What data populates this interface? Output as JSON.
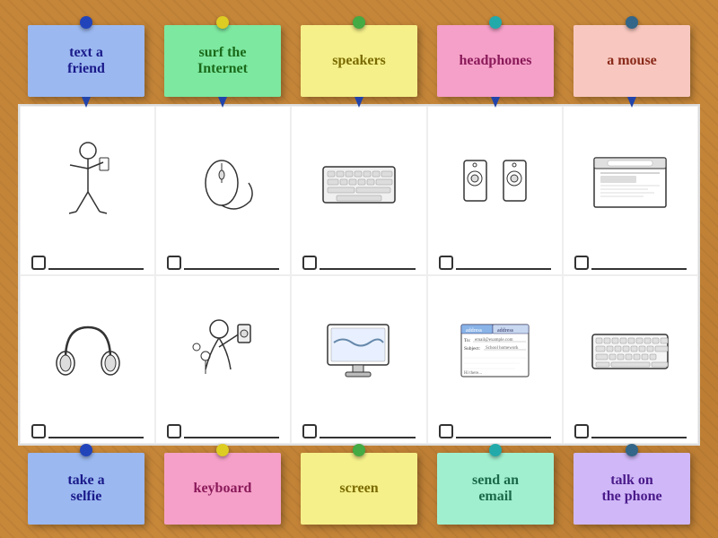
{
  "colors": {
    "cork": "#c8883a",
    "white": "#ffffff"
  },
  "top_notes": [
    {
      "id": "text-a-friend",
      "label": "text a\nfriend",
      "color": "note-blue",
      "pin": "pin-blue"
    },
    {
      "id": "surf-internet",
      "label": "surf the\nInternet",
      "color": "note-green",
      "pin": "pin-yellow"
    },
    {
      "id": "speakers",
      "label": "speakers",
      "color": "note-yellow",
      "pin": "pin-green"
    },
    {
      "id": "headphones",
      "label": "headphones",
      "color": "note-pink",
      "pin": "pin-teal"
    },
    {
      "id": "a-mouse",
      "label": "a mouse",
      "color": "note-salmon",
      "pin": "pin-dark"
    }
  ],
  "bottom_notes": [
    {
      "id": "take-selfie",
      "label": "take a\nselfie",
      "color": "note-blue",
      "pin": "pin-blue"
    },
    {
      "id": "keyboard",
      "label": "keyboard",
      "color": "note-pink",
      "pin": "pin-yellow"
    },
    {
      "id": "screen",
      "label": "screen",
      "color": "note-yellow",
      "pin": "pin-green"
    },
    {
      "id": "send-email",
      "label": "send an\nemail",
      "color": "note-mint",
      "pin": "pin-teal"
    },
    {
      "id": "talk-phone",
      "label": "talk on\nthe phone",
      "color": "note-lavender",
      "pin": "pin-dark"
    }
  ],
  "grid_cells": [
    {
      "id": "cell-person",
      "row": 1,
      "col": 1
    },
    {
      "id": "cell-mouse",
      "row": 1,
      "col": 2
    },
    {
      "id": "cell-keyboard-top",
      "row": 1,
      "col": 3
    },
    {
      "id": "cell-speakers",
      "row": 1,
      "col": 4
    },
    {
      "id": "cell-browser",
      "row": 1,
      "col": 5
    },
    {
      "id": "cell-headphones",
      "row": 2,
      "col": 1
    },
    {
      "id": "cell-selfie",
      "row": 2,
      "col": 2
    },
    {
      "id": "cell-screen",
      "row": 2,
      "col": 3
    },
    {
      "id": "cell-email",
      "row": 2,
      "col": 4
    },
    {
      "id": "cell-keyboard-bot",
      "row": 2,
      "col": 5
    }
  ]
}
